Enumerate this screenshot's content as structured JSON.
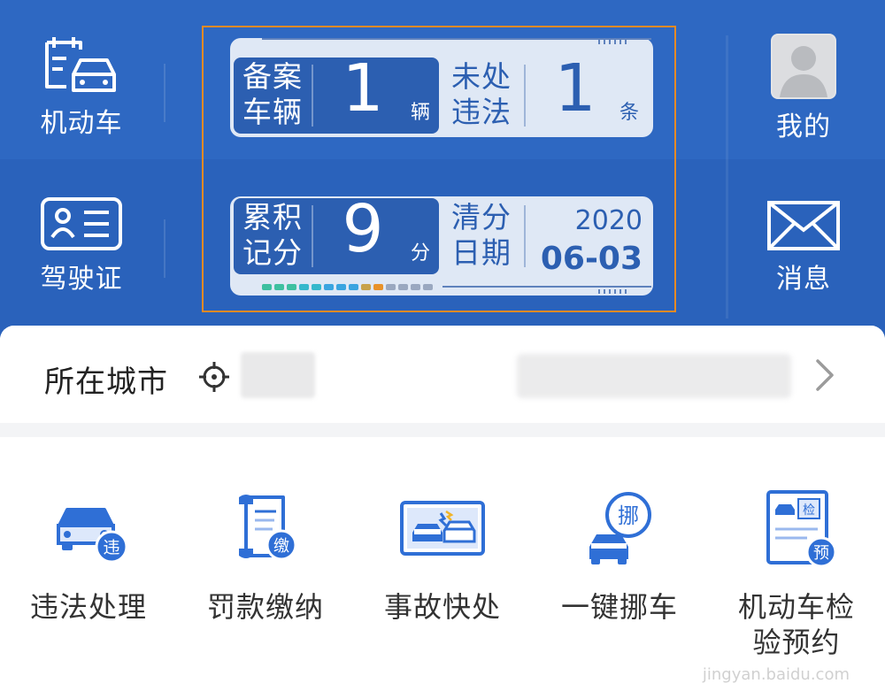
{
  "header": {
    "left_buttons": [
      {
        "label": "机动车",
        "icon": "vehicle-doc-icon"
      },
      {
        "label": "驾驶证",
        "icon": "license-card-icon"
      }
    ],
    "right_buttons": [
      {
        "label": "我的",
        "icon": "avatar"
      },
      {
        "label": "消息",
        "icon": "envelope-icon"
      }
    ]
  },
  "cards": {
    "vehicles": {
      "key_line1": "备案",
      "key_line2": "车辆",
      "value": "1",
      "unit": "辆"
    },
    "violations": {
      "key_line1": "未处",
      "key_line2": "违法",
      "value": "1",
      "unit": "条"
    },
    "points": {
      "key_line1": "累积",
      "key_line2": "记分",
      "value": "9",
      "unit": "分"
    },
    "clear_date": {
      "key_line1": "清分",
      "key_line2": "日期",
      "year": "2020",
      "month_day": "06-03"
    },
    "progress_colors": [
      "#3ec0a0",
      "#3ec0a0",
      "#3ec0a0",
      "#35b8cc",
      "#35b8cc",
      "#3aa4e0",
      "#3aa4e0",
      "#3aa4e0",
      "#c8a24a",
      "#e8922a",
      "#9aa8c0",
      "#9aa8c0",
      "#9aa8c0",
      "#9aa8c0"
    ]
  },
  "city": {
    "label": "所在城市"
  },
  "services": [
    {
      "label": "违法处理",
      "badge": "违"
    },
    {
      "label": "罚款缴纳",
      "badge": "缴"
    },
    {
      "label": "事故快处"
    },
    {
      "label": "一键挪车",
      "badge": "挪"
    },
    {
      "label": "机动车检\n验预约",
      "badge": "预",
      "tag": "检"
    }
  ],
  "watermark": "jingyan.baidu.com",
  "colors": {
    "brand_blue": "#2e68c2",
    "icon_blue": "#2f6fd6",
    "highlight": "#e68a25"
  }
}
